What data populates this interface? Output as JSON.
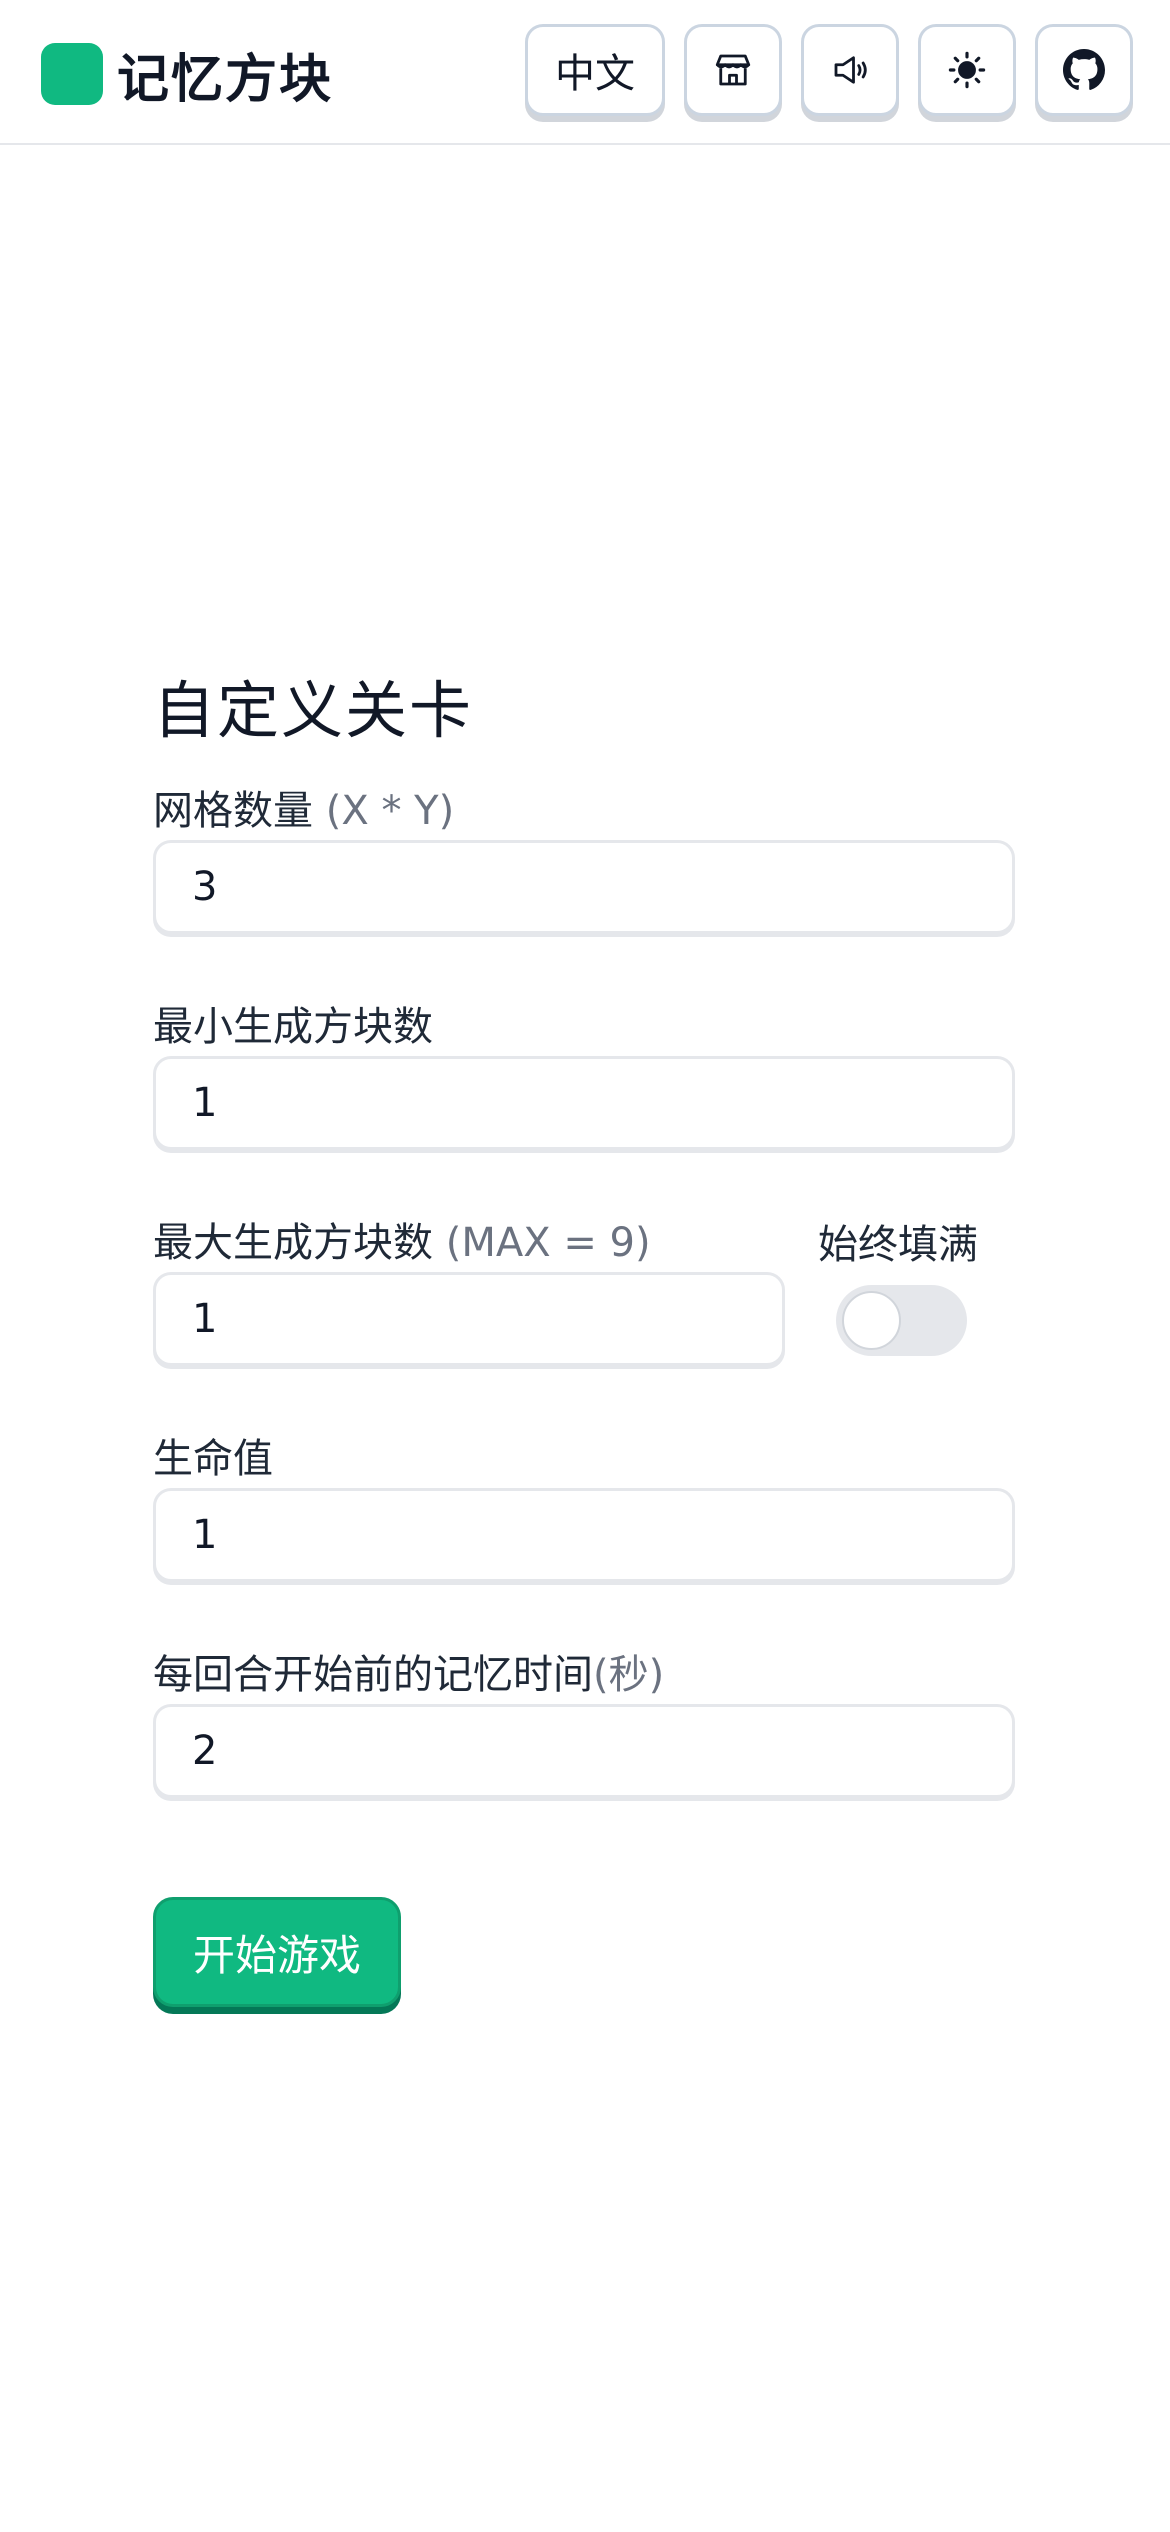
{
  "header": {
    "title": "记忆方块",
    "language_label": "中文",
    "icons": {
      "store": "store-icon",
      "sound": "speaker-icon",
      "theme": "sun-icon",
      "github": "github-icon"
    }
  },
  "form": {
    "title": "自定义关卡",
    "grid": {
      "label": "网格数量",
      "hint": "(X * Y)",
      "value": "3"
    },
    "min_blocks": {
      "label": "最小生成方块数",
      "value": "1"
    },
    "max_blocks": {
      "label": "最大生成方块数",
      "hint": "(MAX = 9)",
      "value": "1"
    },
    "always_fill": {
      "label": "始终填满",
      "checked": false
    },
    "lives": {
      "label": "生命值",
      "value": "1"
    },
    "memory_time": {
      "label": "每回合开始前的记忆时间",
      "hint": "(秒)",
      "value": "2"
    },
    "start_button": "开始游戏"
  },
  "colors": {
    "accent": "#10b981",
    "accent_dark": "#047857",
    "border": "#e5e7eb",
    "hint_text": "#6b7280"
  }
}
